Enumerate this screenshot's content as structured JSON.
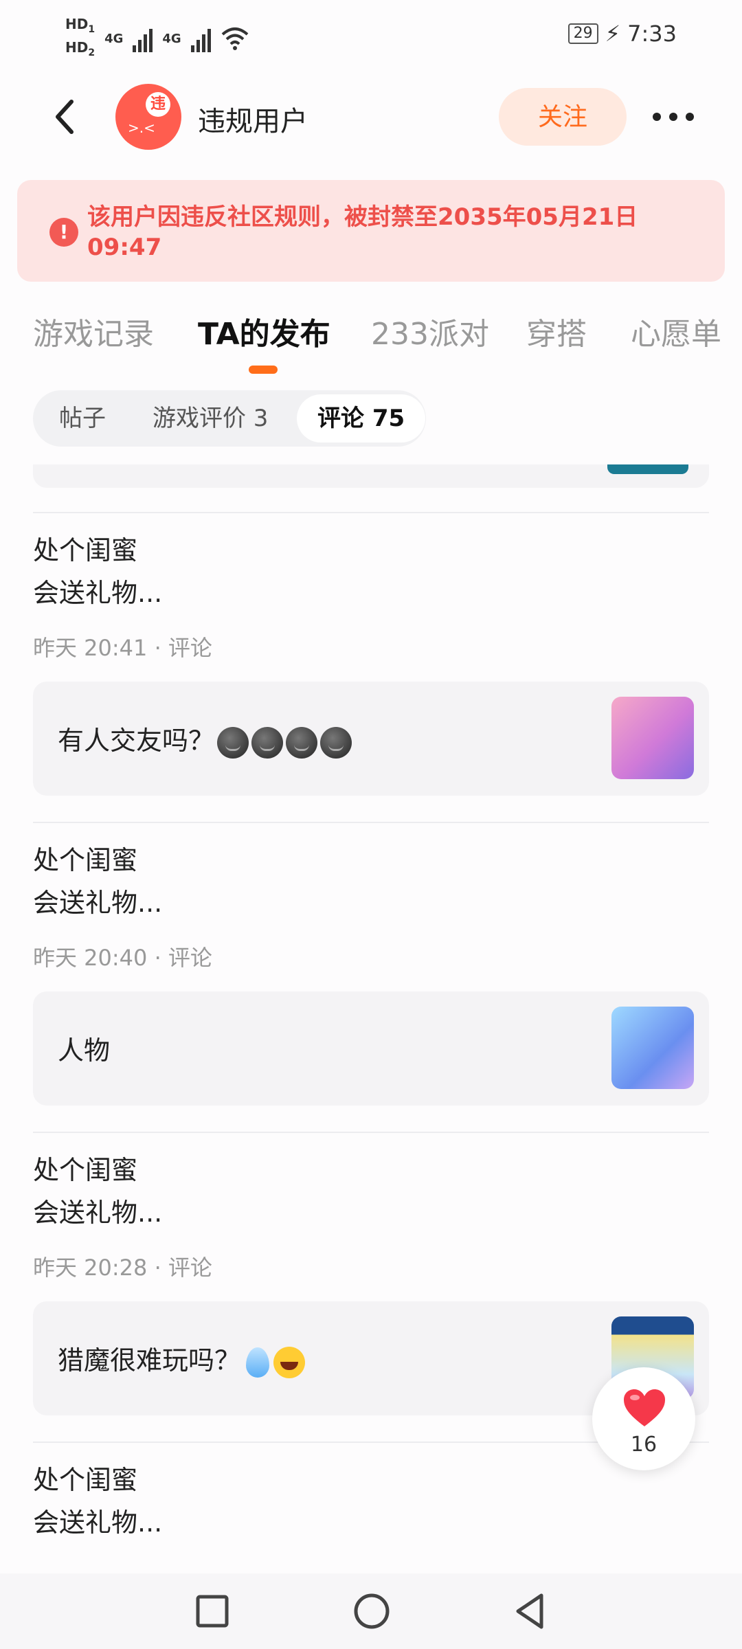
{
  "status_bar": {
    "hd1": "HD",
    "hd1_sub": "1",
    "hd2": "HD",
    "hd2_sub": "2",
    "net1": "4G",
    "net2": "4G",
    "battery": "29",
    "time": "7:33"
  },
  "header": {
    "title": "违规用户",
    "avatar_badge": "违",
    "avatar_face": ">.<",
    "follow_label": "关注"
  },
  "banner": {
    "message": "该用户因违反社区规则，被封禁至2035年05月21日 09:47"
  },
  "tabs": [
    {
      "label": "游戏记录"
    },
    {
      "label": "TA的发布"
    },
    {
      "label": "233派对"
    },
    {
      "label": "穿搭"
    },
    {
      "label": "心愿单"
    }
  ],
  "sub_tabs": [
    {
      "label": "帖子"
    },
    {
      "label": "游戏评价 3"
    },
    {
      "label": "评论 75"
    }
  ],
  "posts": [
    {
      "text": "处个闺蜜\n会送礼物...",
      "meta": "昨天 20:41 · 评论",
      "card_text": "有人交友吗？"
    },
    {
      "text": "处个闺蜜\n会送礼物...",
      "meta": "昨天 20:40 · 评论",
      "card_text": "人物"
    },
    {
      "text": "处个闺蜜\n会送礼物...",
      "meta": "昨天 20:28 · 评论",
      "card_text": "猎魔很难玩吗？"
    },
    {
      "text": "处个闺蜜\n会送礼物..."
    }
  ],
  "like": {
    "count": "16"
  },
  "colors": {
    "accent": "#ff6d1a",
    "danger": "#ed4f4a",
    "banner_bg": "#fde4e3"
  }
}
